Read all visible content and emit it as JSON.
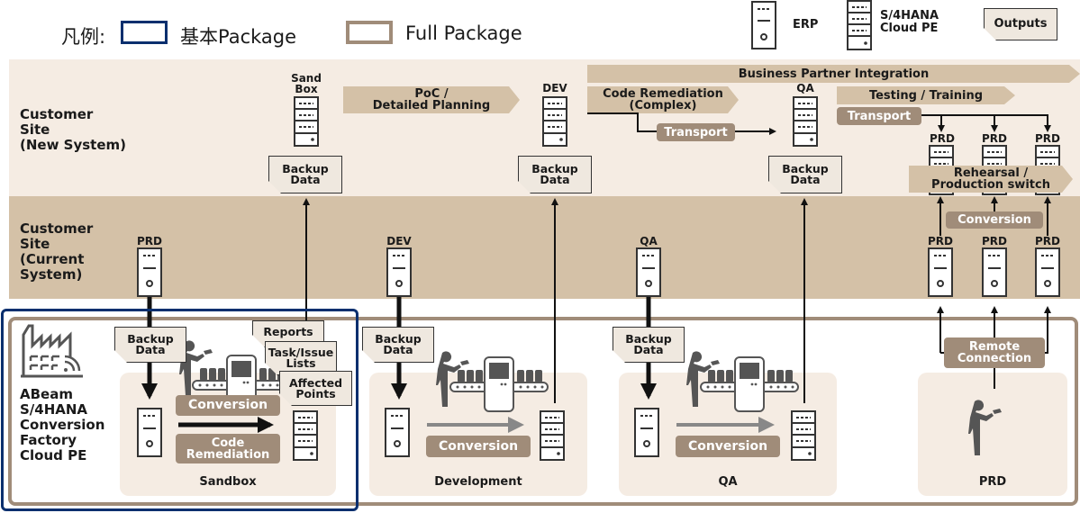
{
  "legend": {
    "prefix": "凡例:",
    "basic_package": "基本Package",
    "full_package": "Full Package",
    "basic_color": "#0a2f6e",
    "full_color": "#a08c79",
    "erp_label": "ERP",
    "s4_label_line1": "S/4HANA",
    "s4_label_line2": "Cloud PE",
    "outputs_label": "Outputs"
  },
  "rows": {
    "new_system": [
      "Customer",
      "Site",
      "(New System)"
    ],
    "current_system": [
      "Customer",
      "Site",
      "(Current",
      "System)"
    ]
  },
  "new_system": {
    "sandbox_label_1": "Sand",
    "sandbox_label_2": "Box",
    "dev_label": "DEV",
    "qa_label": "QA",
    "prd_labels": [
      "PRD",
      "PRD",
      "PRD"
    ],
    "poc_line1": "PoC /",
    "poc_line2": "Detailed Planning",
    "bp_integration": "Business Partner Integration",
    "code_rem_line1": "Code Remediation",
    "code_rem_line2": "(Complex)",
    "transport": "Transport",
    "testing_training": "Testing / Training",
    "transport2": "Transport",
    "rehearsal_line1": "Rehearsal /",
    "rehearsal_line2": "Production switch",
    "backup_line1": "Backup",
    "backup_line2": "Data"
  },
  "current_system": {
    "prd_label": "PRD",
    "dev_label": "DEV",
    "qa_label": "QA",
    "prd_labels": [
      "PRD",
      "PRD",
      "PRD"
    ],
    "conversion": "Conversion"
  },
  "factory": {
    "name_lines": [
      "ABeam",
      "S/4HANA",
      "Conversion",
      "Factory",
      "Cloud PE"
    ],
    "backup_line1": "Backup",
    "backup_line2": "Data",
    "outputs": {
      "reports": "Reports",
      "task_line1": "Task/Issue",
      "task_line2": "Lists",
      "affected_line1": "Affected",
      "affected_line2": "Points"
    },
    "stages": [
      {
        "name": "Sandbox",
        "steps": [
          "Conversion",
          "Code",
          "Remediation"
        ]
      },
      {
        "name": "Development",
        "steps": [
          "Conversion"
        ]
      },
      {
        "name": "QA",
        "steps": [
          "Conversion"
        ]
      },
      {
        "name": "PRD",
        "steps": []
      }
    ],
    "remote_line1": "Remote",
    "remote_line2": "Connection"
  }
}
